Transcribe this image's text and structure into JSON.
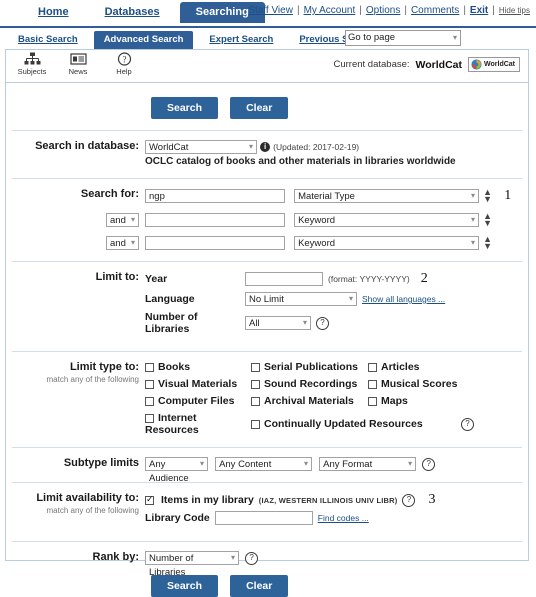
{
  "topnav": {
    "tabs": [
      {
        "label": "Home",
        "active": false
      },
      {
        "label": "Databases",
        "active": false
      },
      {
        "label": "Searching",
        "active": true
      }
    ],
    "links": [
      {
        "label": "Staff View",
        "bold": false
      },
      {
        "label": "My Account",
        "bold": false
      },
      {
        "label": "Options",
        "bold": false
      },
      {
        "label": "Comments",
        "bold": false
      },
      {
        "label": "Exit",
        "bold": true
      }
    ],
    "hide_tips": "Hide tips",
    "separator": "|"
  },
  "subnav": {
    "tabs": [
      {
        "label": "Basic Search",
        "active": false
      },
      {
        "label": "Advanced Search",
        "active": true
      },
      {
        "label": "Expert Search",
        "active": false
      },
      {
        "label": "Previous Searches",
        "active": false
      }
    ],
    "go_to_page": "Go to page"
  },
  "toolbar": {
    "icons": [
      {
        "label": "Subjects",
        "icon": "subjects-tree-icon"
      },
      {
        "label": "News",
        "icon": "news-card-icon"
      },
      {
        "label": "Help",
        "icon": "help-question-icon"
      }
    ],
    "current_database_label": "Current database:",
    "current_database_value": "WorldCat",
    "logo_text": "WorldCat"
  },
  "buttons": {
    "search": "Search",
    "clear": "Clear"
  },
  "search_in_database": {
    "label": "Search in database:",
    "value": "WorldCat",
    "updated": "(Updated: 2017-02-19)",
    "description": "OCLC catalog of books and other materials in libraries worldwide"
  },
  "search_for": {
    "label": "Search for:",
    "rows": [
      {
        "boolean": null,
        "term": "ngp",
        "index": "Material Type",
        "annotation": "1"
      },
      {
        "boolean": "and",
        "term": "",
        "index": "Keyword",
        "annotation": ""
      },
      {
        "boolean": "and",
        "term": "",
        "index": "Keyword",
        "annotation": ""
      }
    ]
  },
  "limit_to": {
    "label": "Limit to:",
    "year_label": "Year",
    "year_value": "",
    "year_format": "(format: YYYY-YYYY)",
    "annotation": "2",
    "language_label": "Language",
    "language_value": "No Limit",
    "show_all_languages": "Show all languages ...",
    "num_libraries_label": "Number of Libraries",
    "num_libraries_value": "All"
  },
  "limit_type_to": {
    "label": "Limit type to:",
    "sublabel": "match any of the following",
    "options": [
      {
        "label": "Books",
        "checked": false
      },
      {
        "label": "Serial Publications",
        "checked": false
      },
      {
        "label": "Articles",
        "checked": false
      },
      {
        "label": "Visual Materials",
        "checked": false
      },
      {
        "label": "Sound Recordings",
        "checked": false
      },
      {
        "label": "Musical Scores",
        "checked": false
      },
      {
        "label": "Computer Files",
        "checked": false
      },
      {
        "label": "Archival Materials",
        "checked": false
      },
      {
        "label": "Maps",
        "checked": false
      },
      {
        "label": "Internet Resources",
        "checked": false
      },
      {
        "label": "Continually Updated Resources",
        "checked": false
      }
    ]
  },
  "subtype_limits": {
    "label": "Subtype limits",
    "audience": "Any Audience",
    "content": "Any Content",
    "format": "Any Format"
  },
  "limit_availability": {
    "label": "Limit availability to:",
    "sublabel": "match any of the following",
    "items_in_my_library": "Items in my library",
    "library_detail": "(IAZ, WESTERN ILLINOIS UNIV LIBR)",
    "checked": true,
    "annotation": "3",
    "library_code_label": "Library Code",
    "library_code_value": "",
    "find_codes": "Find codes ..."
  },
  "rank_by": {
    "label": "Rank by:",
    "value": "Number of Libraries"
  },
  "colors": {
    "accent": "#2f5f96",
    "button": "#2e6399",
    "link": "#1c4f85",
    "frame_border": "#b9cde0"
  }
}
